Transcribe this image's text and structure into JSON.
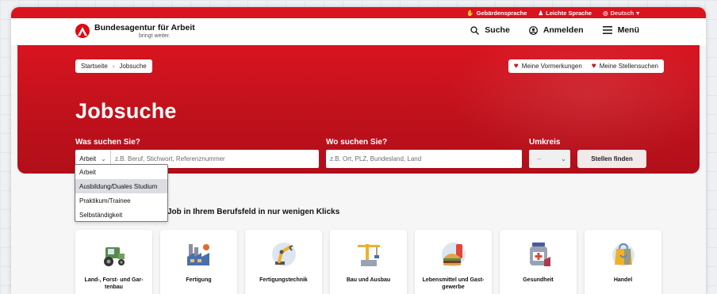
{
  "utilbar": {
    "sign_language": "Gebärdensprache",
    "easy_language": "Leichte Sprache",
    "language": "Deutsch"
  },
  "header": {
    "logo_name": "Bundesagentur für Arbeit",
    "logo_claim": "bringt weiter.",
    "search_label": "Suche",
    "login_label": "Anmelden",
    "menu_label": "Menü"
  },
  "breadcrumb": {
    "home": "Startseite",
    "current": "Jobsuche"
  },
  "favorites": {
    "bookmarks": "Meine Vormerkungen",
    "job_searches": "Meine Stellensuchen"
  },
  "hero": {
    "title": "Jobsuche",
    "what_label": "Was suchen Sie?",
    "where_label": "Wo suchen Sie?",
    "radius_label": "Umkreis"
  },
  "search": {
    "type_selected": "Arbeit",
    "what_placeholder": "z.B. Beruf, Stichwort, Referenznummer",
    "where_placeholder": "z.B. Ort, PLZ, Bundesland, Land",
    "radius_value": "--",
    "submit_label": "Stellen finden"
  },
  "type_dropdown": {
    "options": [
      "Arbeit",
      "Ausbildung/Duales Studium",
      "Praktikum/Trainee",
      "Selbständigkeit"
    ],
    "highlighted_index": 1
  },
  "categories": {
    "heading": "Job in Ihrem Berufsfeld in nur wenigen Klicks",
    "items": [
      {
        "label": "Land-, Forst- und Gar-\ntenbau",
        "icon": "tractor-icon"
      },
      {
        "label": "Fertigung",
        "icon": "factory-icon"
      },
      {
        "label": "Fertigungstechnik",
        "icon": "robot-arm-icon"
      },
      {
        "label": "Bau und Ausbau",
        "icon": "crane-icon"
      },
      {
        "label": "Lebensmittel und Gast-\ngewerbe",
        "icon": "food-icon"
      },
      {
        "label": "Gesundheit",
        "icon": "medicine-icon"
      },
      {
        "label": "Handel",
        "icon": "shopping-bag-icon"
      }
    ]
  },
  "colors": {
    "brand_red": "#d8141f",
    "hero_dark_red": "#b10f1a",
    "dropdown_highlight": "#dcdde2"
  }
}
